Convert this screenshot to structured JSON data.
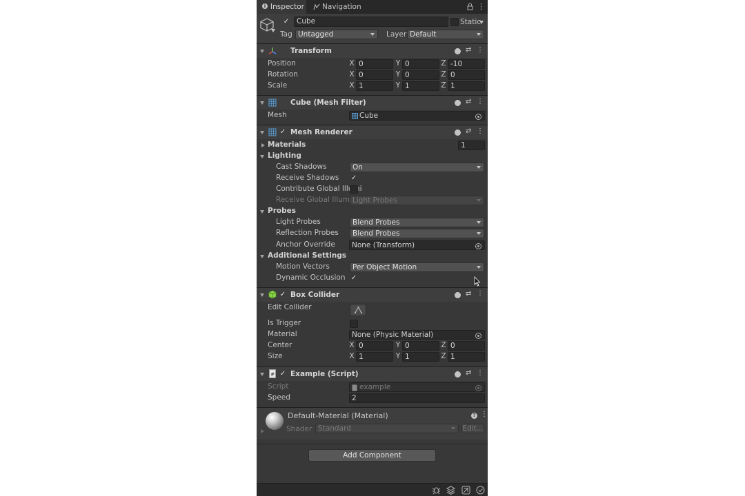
{
  "tabs": [
    {
      "label": "Inspector"
    },
    {
      "label": "Navigation"
    }
  ],
  "object": {
    "name": "Cube",
    "static_label": "Static",
    "tag_label": "Tag",
    "tag_value": "Untagged",
    "layer_label": "Layer",
    "layer_value": "Default"
  },
  "transform": {
    "title": "Transform",
    "rows": [
      {
        "label": "Position",
        "x": "0",
        "y": "0",
        "z": "-10"
      },
      {
        "label": "Rotation",
        "x": "0",
        "y": "0",
        "z": "0"
      },
      {
        "label": "Scale",
        "x": "1",
        "y": "1",
        "z": "1"
      }
    ]
  },
  "axes": {
    "x": "X",
    "y": "Y",
    "z": "Z"
  },
  "mesh_filter": {
    "title": "Cube (Mesh Filter)",
    "mesh_label": "Mesh",
    "mesh_value": "Cube"
  },
  "mesh_renderer": {
    "title": "Mesh Renderer",
    "materials_label": "Materials",
    "materials_count": "1",
    "lighting_label": "Lighting",
    "cast_shadows_label": "Cast Shadows",
    "cast_shadows_value": "On",
    "receive_shadows_label": "Receive Shadows",
    "contribute_gi_label": "Contribute Global Illumi",
    "receive_gi_label": "Receive Global Illumina",
    "receive_gi_value": "Light Probes",
    "probes_label": "Probes",
    "light_probes_label": "Light Probes",
    "light_probes_value": "Blend Probes",
    "reflection_probes_label": "Reflection Probes",
    "reflection_probes_value": "Blend Probes",
    "anchor_override_label": "Anchor Override",
    "anchor_override_value": "None (Transform)",
    "additional_label": "Additional Settings",
    "motion_vectors_label": "Motion Vectors",
    "motion_vectors_value": "Per Object Motion",
    "dynamic_occlusion_label": "Dynamic Occlusion"
  },
  "box_collider": {
    "title": "Box Collider",
    "edit_collider_label": "Edit Collider",
    "is_trigger_label": "Is Trigger",
    "material_label": "Material",
    "material_value": "None (Physic Material)",
    "center": {
      "label": "Center",
      "x": "0",
      "y": "0",
      "z": "0"
    },
    "size": {
      "label": "Size",
      "x": "1",
      "y": "1",
      "z": "1"
    }
  },
  "script": {
    "title": "Example (Script)",
    "script_label": "Script",
    "script_value": "example",
    "speed_label": "Speed",
    "speed_value": "2"
  },
  "material": {
    "title": "Default-Material (Material)",
    "shader_label": "Shader",
    "shader_value": "Standard",
    "edit_label": "Edit..."
  },
  "add_component_label": "Add Component",
  "colors": {
    "panel": "#383838",
    "header": "#3e3e3e",
    "field": "#2a2a2a",
    "dropdown": "#515151",
    "text": "#c4c4c4"
  }
}
